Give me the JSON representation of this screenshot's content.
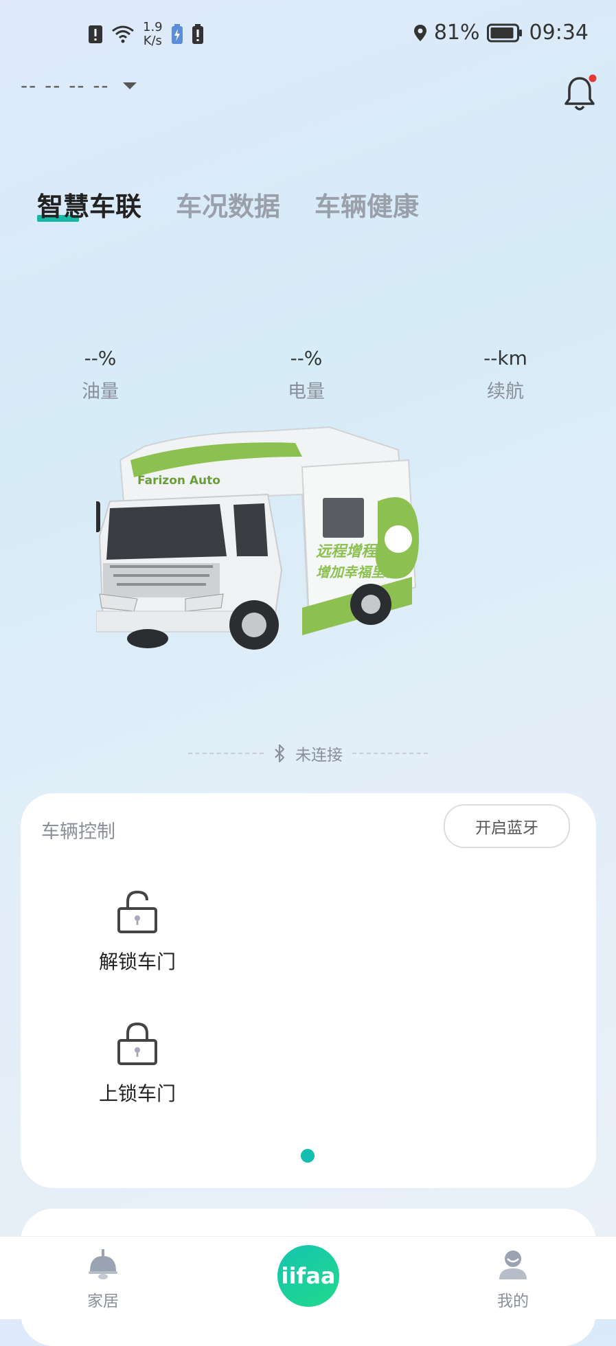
{
  "status_bar": {
    "speed_value": "1.9",
    "speed_unit": "K/s",
    "battery_percent": "81%",
    "time": "09:34"
  },
  "header": {
    "account_placeholder": "-- -- -- --"
  },
  "tabs": [
    {
      "label": "智慧车联",
      "active": true
    },
    {
      "label": "车况数据",
      "active": false
    },
    {
      "label": "车辆健康",
      "active": false
    }
  ],
  "stats": {
    "fuel": {
      "value": "--%",
      "label": "油量"
    },
    "battery": {
      "value": "--%",
      "label": "电量"
    },
    "range": {
      "value": "--km",
      "label": "续航"
    }
  },
  "vehicle": {
    "brand_text": "Farizon Auto",
    "side_text_1": "远程增程",
    "side_text_2": "增加幸福里程"
  },
  "bluetooth": {
    "status": "未连接"
  },
  "vehicle_control": {
    "title": "车辆控制",
    "bt_button": "开启蓝牙",
    "unlock_label": "解锁车门",
    "lock_label": "上锁车门"
  },
  "bottom_nav": {
    "home": "家居",
    "center": "iifaa",
    "mine": "我的"
  },
  "colors": {
    "accent": "#17b8a6",
    "center_button": "#1ccf9c",
    "notification_dot": "#e53935",
    "vehicle_green": "#8cc152"
  }
}
